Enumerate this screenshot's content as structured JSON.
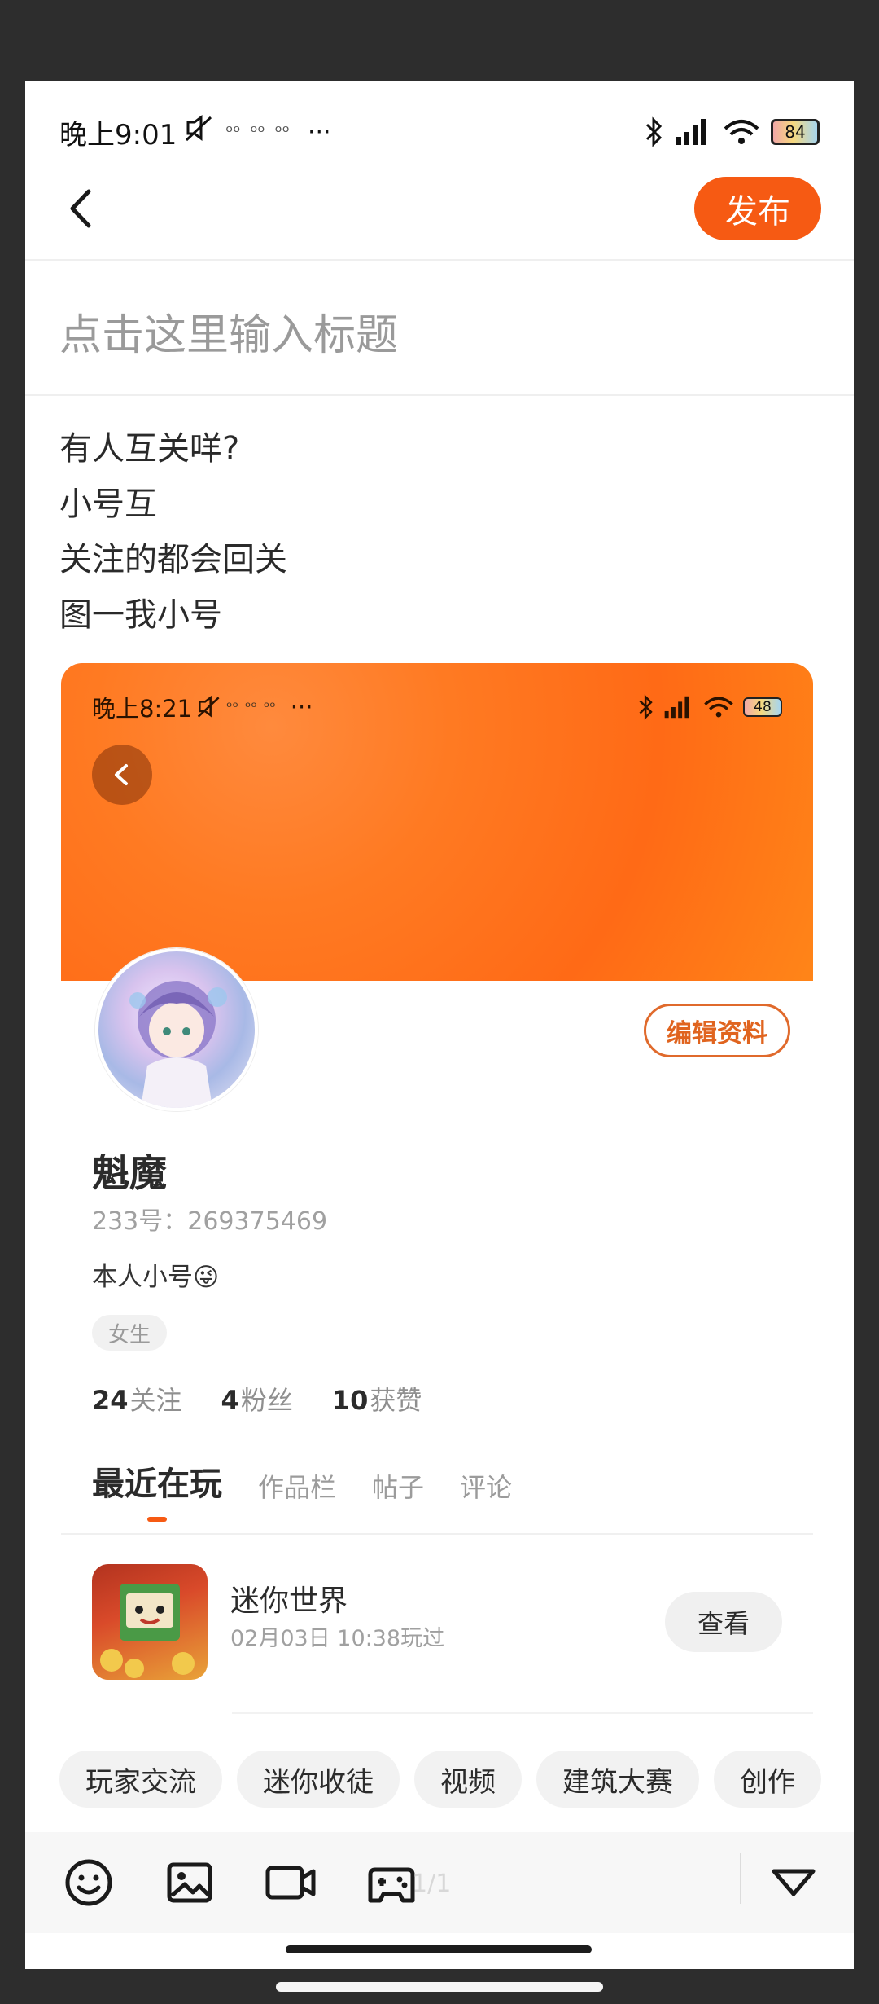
{
  "status_bar": {
    "time": "晚上9:01",
    "notifications": [
      "ᵒᵒ",
      "ᵒᵒ",
      "ᵒᵒ"
    ],
    "more": "···",
    "battery": "84"
  },
  "nav": {
    "publish_label": "发布"
  },
  "title_placeholder": "点击这里输入标题",
  "body_lines": [
    "有人互关咩?",
    "小号互",
    "关注的都会回关",
    "图一我小号"
  ],
  "embedded_screenshot": {
    "status_time": "晚上8:21",
    "status_more": "···",
    "battery": "48",
    "edit_profile_label": "编辑资料",
    "nickname": "魁魔",
    "uid": "233号：269375469",
    "bio": "本人小号😜",
    "gender_tag": "女生",
    "stats": {
      "following_count": "24",
      "following_label": "关注",
      "fans_count": "4",
      "fans_label": "粉丝",
      "likes_count": "10",
      "likes_label": "获赞"
    },
    "tabs": [
      "最近在玩",
      "作品栏",
      "帖子",
      "评论"
    ],
    "game": {
      "name": "迷你世界",
      "played_time": "02月03日 10:38玩过",
      "view_label": "查看"
    }
  },
  "topic_chips": [
    "玩家交流",
    "迷你收徒",
    "视频",
    "建筑大赛",
    "创作"
  ],
  "page_counter": "1/1",
  "colors": {
    "accent": "#f65a13",
    "header_orange": "#ff6f1a",
    "frame_bg": "#2d2d2d"
  },
  "toolbar_icons": [
    "emoji-icon",
    "image-icon",
    "video-icon",
    "game-controller-icon",
    "collapse-triangle-icon"
  ]
}
